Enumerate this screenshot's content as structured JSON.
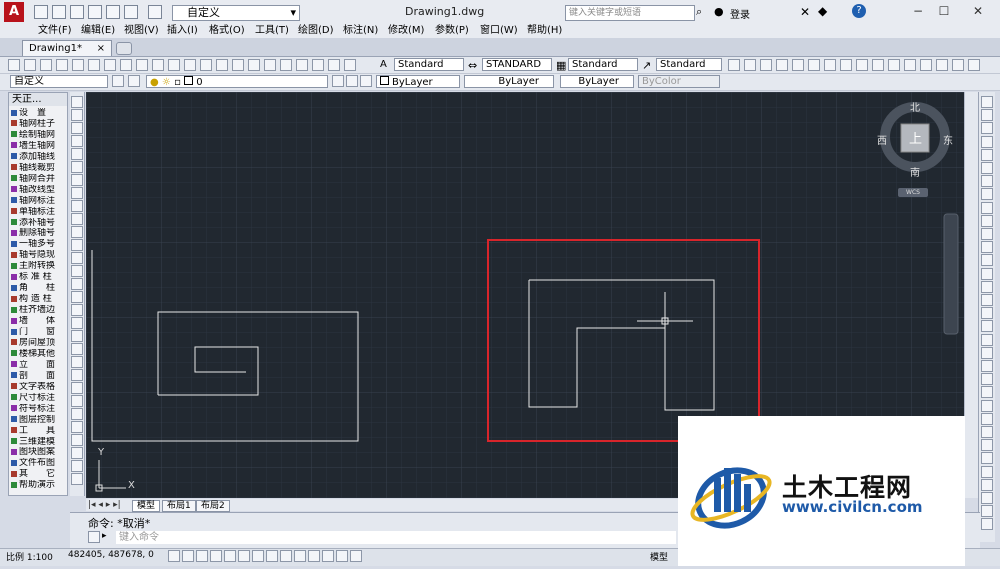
{
  "window": {
    "title": "Drawing1.dwg",
    "workspace": "自定义",
    "search_placeholder": "键入关键字或短语",
    "login": "登录"
  },
  "menu": [
    "文件(F)",
    "编辑(E)",
    "视图(V)",
    "插入(I)",
    "格式(O)",
    "工具(T)",
    "绘图(D)",
    "标注(N)",
    "修改(M)",
    "参数(P)",
    "窗口(W)",
    "帮助(H)"
  ],
  "doc_tab": {
    "label": "Drawing1*",
    "close": "×"
  },
  "styles": {
    "text_style": "Standard",
    "dim_style": "STANDARD",
    "table_style": "Standard",
    "multileader_style": "Standard"
  },
  "layers": {
    "workspace2": "自定义",
    "current_layer": "0",
    "color": "ByLayer",
    "linetype": "ByLayer",
    "lineweight": "ByLayer",
    "plotstyle": "ByColor"
  },
  "tianzheng": {
    "title": "天正...",
    "items": [
      "设　置",
      "轴网柱子",
      "绘制轴网",
      "墙生轴网",
      "添加轴线",
      "轴线裁剪",
      "轴网合并",
      "轴改线型",
      "轴网标注",
      "单轴标注",
      "添补轴号",
      "删除轴号",
      "一轴多号",
      "轴号隐现",
      "主附转换",
      "标 准 柱",
      "角　　柱",
      "构 造 柱",
      "柱齐墙边",
      "墙　　体",
      "门　　窗",
      "房间屋顶",
      "楼梯其他",
      "立　　面",
      "剖　　面",
      "文字表格",
      "尺寸标注",
      "符号标注",
      "图层控制",
      "工　　具",
      "三维建模",
      "图块图案",
      "文件布图",
      "其　　它",
      "帮助演示"
    ]
  },
  "viewcube": {
    "top_face": "上",
    "north": "北",
    "south": "南",
    "east": "东",
    "west": "西",
    "ucs": "WCS"
  },
  "ucs_icon": {
    "x_label": "X",
    "y_label": "Y"
  },
  "layout_tabs": [
    "模型",
    "布局1",
    "布局2"
  ],
  "command": {
    "history": "命令: *取消*",
    "prompt_placeholder": "键入命令"
  },
  "status": {
    "scale": "比例 1:100",
    "coords": "482405, 487678, 0",
    "model": "模型"
  },
  "watermark": {
    "name": "土木工程网",
    "url": "www.civilcn.com"
  },
  "colors": {
    "canvas_bg": "#212830",
    "selection_box": "#d8252b",
    "brand_blue": "#1e5aa8"
  }
}
